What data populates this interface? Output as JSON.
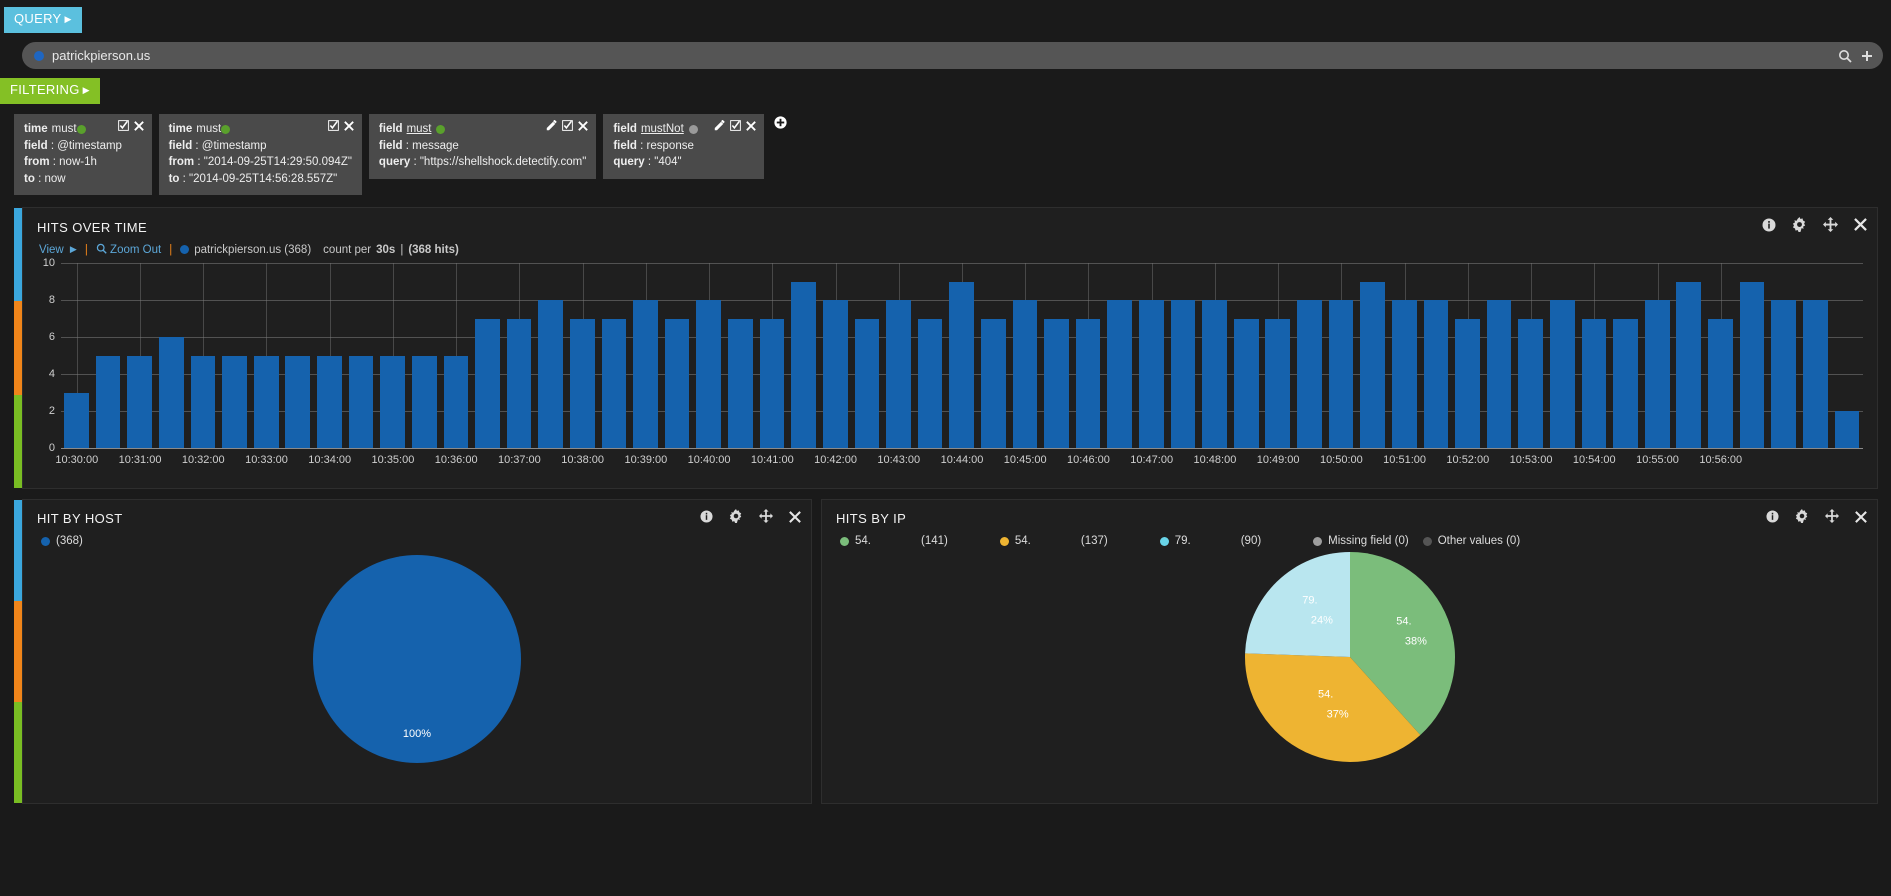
{
  "query": {
    "tab_label": "QUERY",
    "value": "patrickpierson.us",
    "dot_color": "#1f66c1",
    "search_icon": "search-icon",
    "add_icon": "add-query-icon"
  },
  "filtering": {
    "tab_label": "FILTERING",
    "add_filter_label": "+",
    "filters": [
      {
        "type": "time",
        "mode": "must",
        "mode_underlined": false,
        "dot": "green",
        "actions": [
          "toggle-icon",
          "close-icon"
        ],
        "lines": [
          {
            "key": "field",
            "value": ": @timestamp"
          },
          {
            "key": "from",
            "value": ": now-1h"
          },
          {
            "key": "to",
            "value": ": now"
          }
        ]
      },
      {
        "type": "time",
        "mode": "must",
        "mode_underlined": false,
        "dot": "green",
        "actions": [
          "toggle-icon",
          "close-icon"
        ],
        "lines": [
          {
            "key": "field",
            "value": ": @timestamp"
          },
          {
            "key": "from",
            "value": ": \"2014-09-25T14:29:50.094Z\""
          },
          {
            "key": "to",
            "value": ": \"2014-09-25T14:56:28.557Z\""
          }
        ]
      },
      {
        "type": "field",
        "mode": "must",
        "mode_underlined": true,
        "dot": "green",
        "actions": [
          "edit-icon",
          "toggle-icon",
          "close-icon"
        ],
        "lines": [
          {
            "key": "field",
            "value": ": message"
          },
          {
            "key": "query",
            "value": ": \"https://shellshock.detectify.com\""
          }
        ]
      },
      {
        "type": "field",
        "mode": "mustNot",
        "mode_underlined": true,
        "dot": "grey",
        "actions": [
          "edit-icon",
          "toggle-icon",
          "close-icon"
        ],
        "lines": [
          {
            "key": "field",
            "value": ": response"
          },
          {
            "key": "query",
            "value": ": \"404\""
          }
        ]
      }
    ]
  },
  "hits_panel": {
    "title": "HITS OVER TIME",
    "view_label": "View",
    "zoom_out_label": "Zoom Out",
    "series_label": "patrickpierson.us (368)",
    "interval_prefix": "count per",
    "interval": "30s",
    "total_label": "(368 hits)",
    "series_dot_color": "#1562ad",
    "icons": [
      "info-icon",
      "gear-icon",
      "move-icon",
      "close-icon"
    ]
  },
  "host_panel": {
    "title": "HIT BY HOST",
    "legend_label": "(368)",
    "legend_dot_color": "#1562ad",
    "slice_label": "100%",
    "icons": [
      "info-icon",
      "gear-icon",
      "move-icon",
      "close-icon"
    ]
  },
  "ip_panel": {
    "title": "HITS BY IP",
    "icons": [
      "info-icon",
      "gear-icon",
      "move-icon",
      "close-icon"
    ],
    "legend": [
      {
        "label": "54.",
        "count": "(141)",
        "color": "#7bbd7b"
      },
      {
        "label": "54.",
        "count": "(137)",
        "color": "#eeb432"
      },
      {
        "label": "79.",
        "count": "(90)",
        "color": "#69d4e8"
      },
      {
        "label": "Missing field (0)",
        "count": "",
        "color": "#9e9e9e"
      },
      {
        "label": "Other values (0)",
        "count": "",
        "color": "#555555"
      }
    ]
  },
  "chart_data": [
    {
      "type": "bar",
      "title": "HITS OVER TIME",
      "xlabel": "",
      "ylabel": "",
      "ylim": [
        0,
        10
      ],
      "yticks": [
        0,
        2,
        4,
        6,
        8,
        10
      ],
      "grid": true,
      "xtick_labels": [
        "10:30:00",
        "10:31:00",
        "10:32:00",
        "10:33:00",
        "10:34:00",
        "10:35:00",
        "10:36:00",
        "10:37:00",
        "10:38:00",
        "10:39:00",
        "10:40:00",
        "10:41:00",
        "10:42:00",
        "10:43:00",
        "10:44:00",
        "10:45:00",
        "10:46:00",
        "10:47:00",
        "10:48:00",
        "10:49:00",
        "10:50:00",
        "10:51:00",
        "10:52:00",
        "10:53:00",
        "10:54:00",
        "10:55:00",
        "10:56:00"
      ],
      "values": [
        3,
        5,
        5,
        6,
        5,
        5,
        5,
        5,
        5,
        5,
        5,
        5,
        5,
        7,
        7,
        8,
        7,
        7,
        8,
        7,
        8,
        7,
        7,
        9,
        8,
        7,
        8,
        7,
        9,
        7,
        8,
        7,
        7,
        8,
        8,
        8,
        8,
        7,
        7,
        8,
        8,
        9,
        8,
        8,
        7,
        8,
        7,
        8,
        7,
        7,
        8,
        9,
        7,
        9,
        8,
        8,
        2
      ],
      "legend": [
        "patrickpierson.us (368)"
      ],
      "series_color": "#1562ad"
    },
    {
      "type": "pie",
      "title": "HIT BY HOST",
      "labels": [
        ""
      ],
      "values": [
        368
      ],
      "percent_labels": [
        "100%"
      ],
      "colors": [
        "#1562ad"
      ],
      "legend": [
        "(368)"
      ]
    },
    {
      "type": "pie",
      "title": "HITS BY IP",
      "labels": [
        "54.",
        "54.",
        "79.",
        "Missing field",
        "Other values"
      ],
      "values": [
        141,
        137,
        90,
        0,
        0
      ],
      "percent_labels": [
        "38%",
        "37%",
        "24%",
        "",
        ""
      ],
      "colors": [
        "#7bbd7b",
        "#eeb432",
        "#b9e6ef",
        "#9e9e9e",
        "#555555"
      ],
      "legend": [
        "54. (141)",
        "54. (137)",
        "79. (90)",
        "Missing field (0)",
        "Other values (0)"
      ]
    }
  ]
}
